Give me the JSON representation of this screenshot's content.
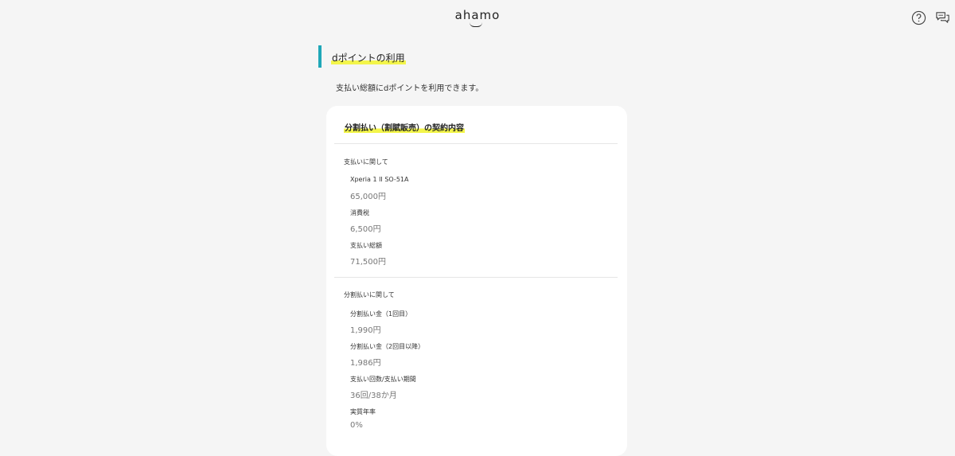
{
  "header": {
    "logo_text": "ahamo",
    "help_icon": "help-circle-icon",
    "chat_icon": "chat-bubbles-icon"
  },
  "section": {
    "title": "dポイントの利用",
    "intro": "支払い総額にdポイントを利用できます。"
  },
  "card": {
    "title": "分割払い（割賦販売）の契約内容",
    "payment_group": {
      "label": "支払いに関して",
      "items": [
        {
          "label": "Xperia 1 II SO-51A",
          "value": "65,000円"
        },
        {
          "label": "消費税",
          "value": "6,500円"
        },
        {
          "label": "支払い総額",
          "value": "71,500円"
        }
      ]
    },
    "installment_group": {
      "label": "分割払いに関して",
      "items": [
        {
          "label": "分割払い金（1回目）",
          "value": "1,990円"
        },
        {
          "label": "分割払い金（2回目以降）",
          "value": "1,986円"
        },
        {
          "label": "支払い回数/支払い期間",
          "value": "36回/38か月"
        },
        {
          "label": "実質年率",
          "value": "0%"
        }
      ]
    }
  },
  "colors": {
    "accent_bar": "#1fa7b8",
    "highlight": "#f3f54a",
    "background": "#f5f5f5"
  }
}
